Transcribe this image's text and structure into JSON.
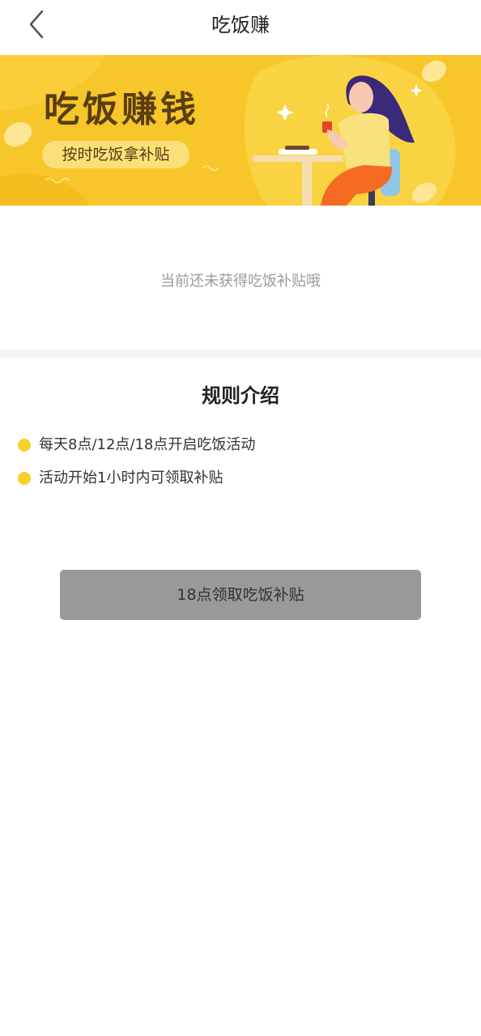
{
  "header": {
    "title": "吃饭赚",
    "back_icon": "chevron-left-icon"
  },
  "banner": {
    "title": "吃饭赚钱",
    "subtitle": "按时吃饭拿补贴",
    "colors": {
      "background": "#f7c62a",
      "title": "#5a3d10",
      "pill": "#fbe07a"
    }
  },
  "empty_state": {
    "message": "当前还未获得吃饭补贴哦"
  },
  "rules": {
    "title": "规则介绍",
    "items": [
      "每天8点/12点/18点开启吃饭活动",
      "活动开始1小时内可领取补贴"
    ],
    "bullet_color": "#f8d02a"
  },
  "claim_button": {
    "label": "18点领取吃饭补贴",
    "background": "#999999"
  }
}
